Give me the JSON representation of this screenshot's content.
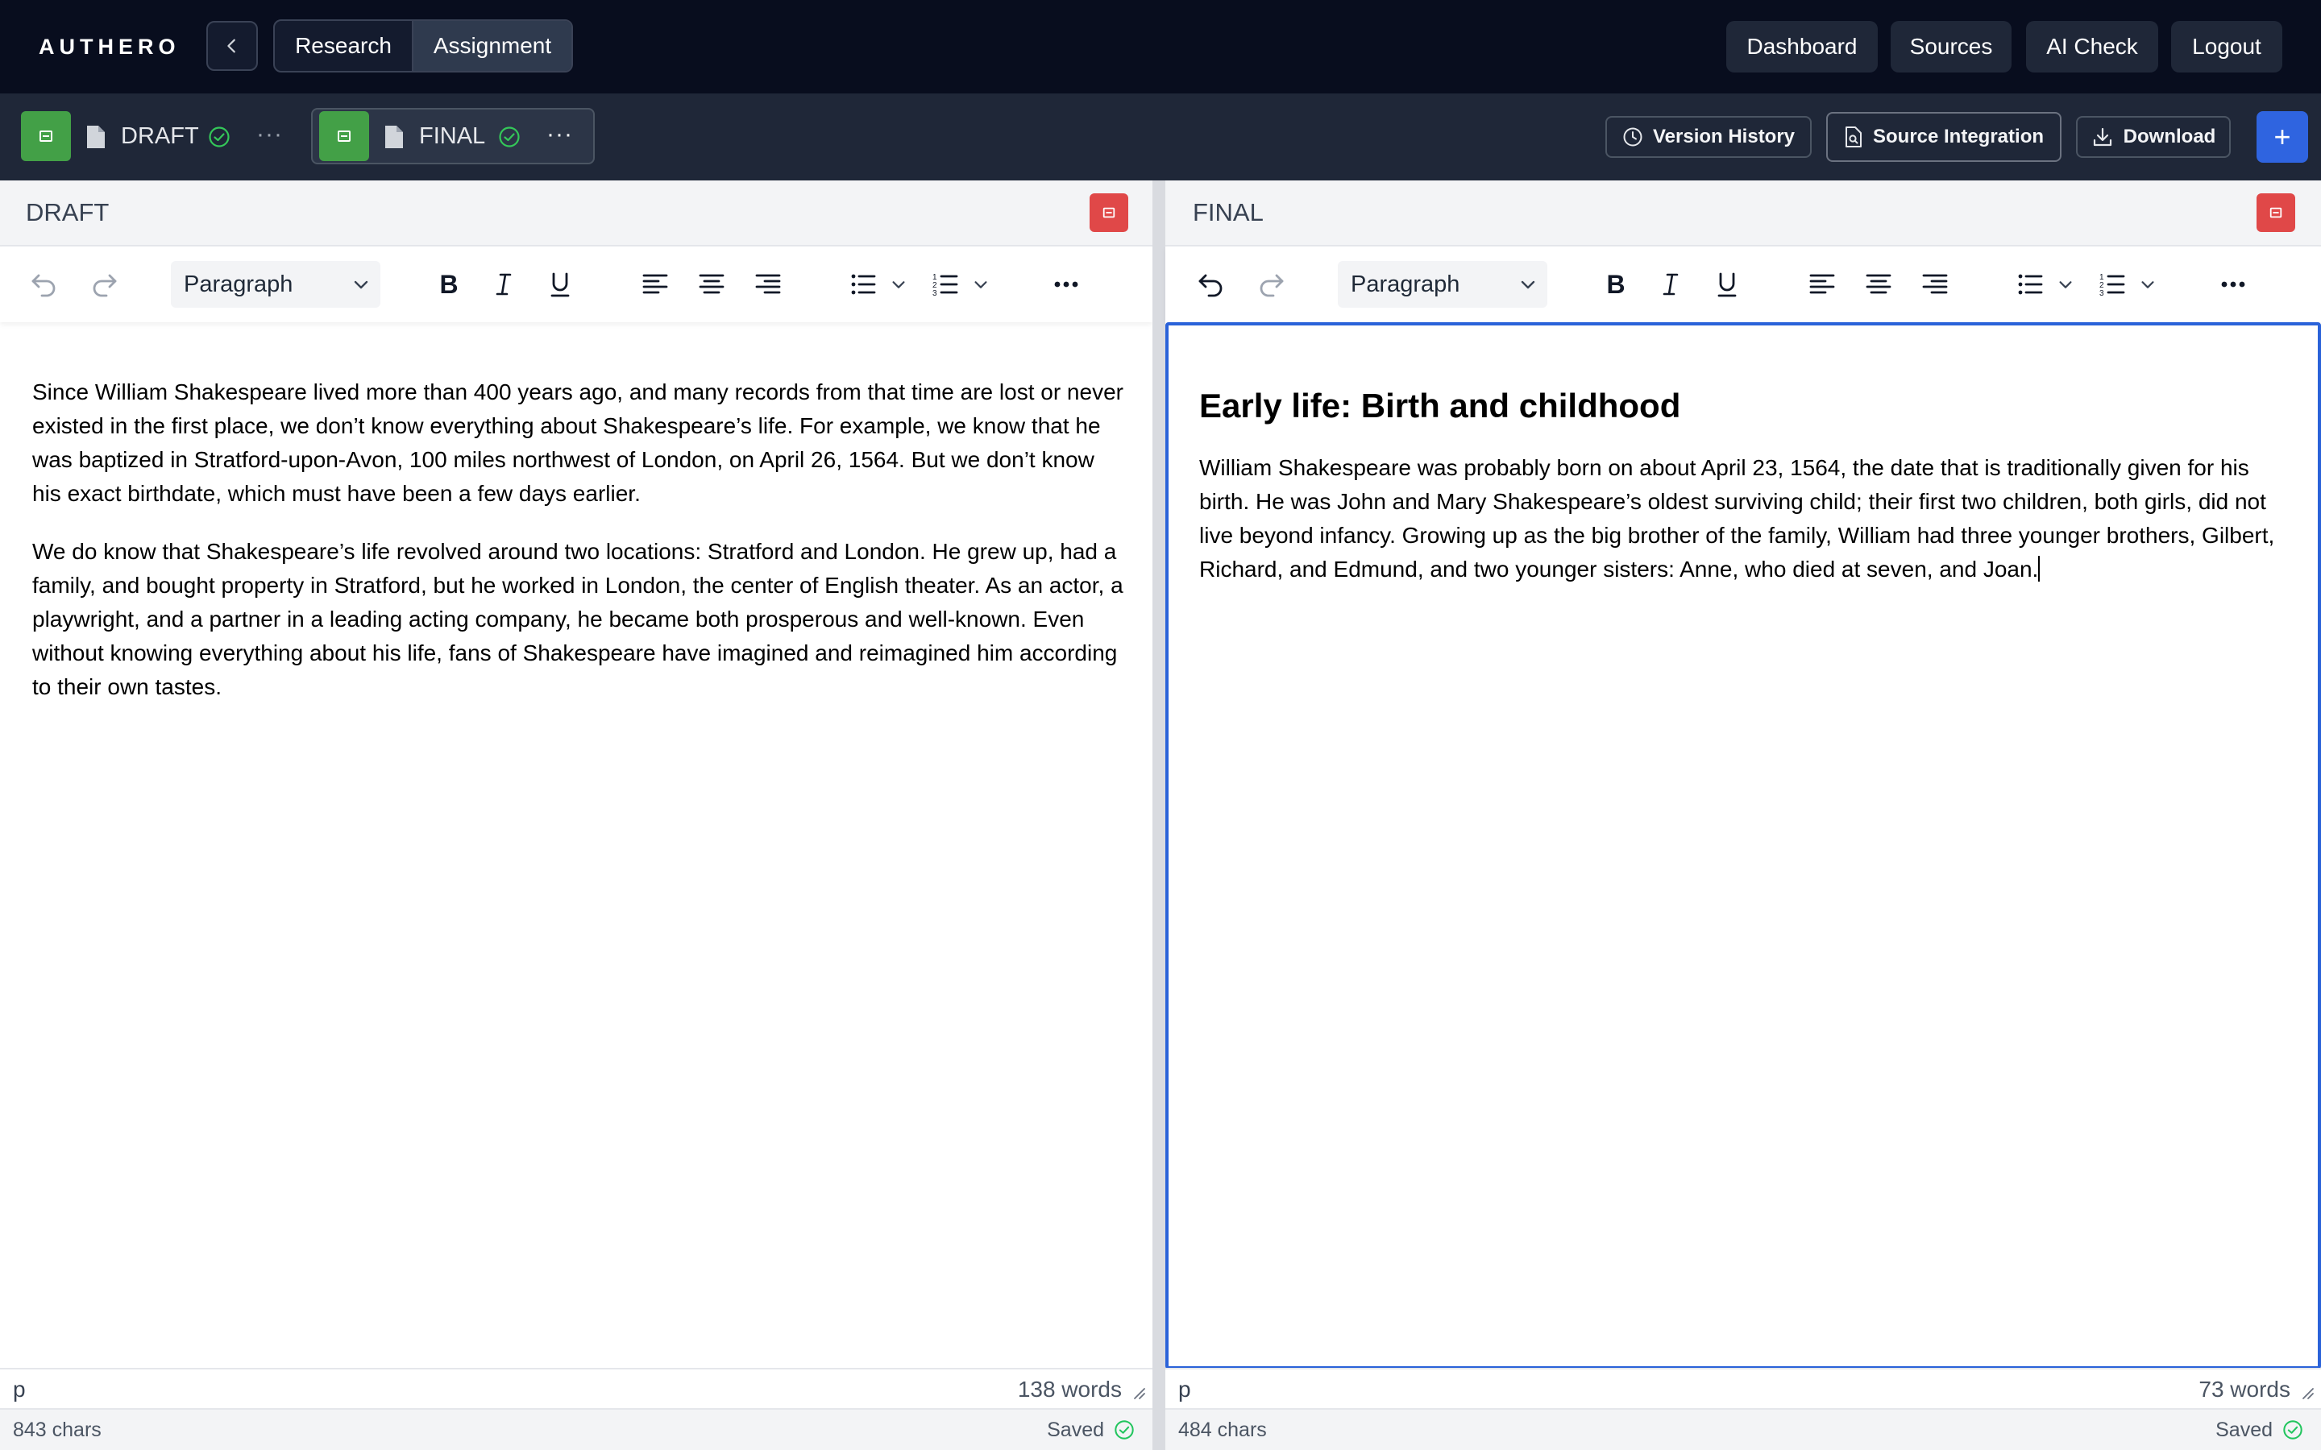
{
  "app": {
    "brand": "AUTHERO",
    "mode_tabs": [
      {
        "label": "Research",
        "active": false
      },
      {
        "label": "Assignment",
        "active": true
      }
    ],
    "nav": {
      "dashboard": "Dashboard",
      "sources": "Sources",
      "ai_check": "AI Check",
      "logout": "Logout"
    }
  },
  "docbar": {
    "tabs": [
      {
        "label": "DRAFT",
        "status": "saved"
      },
      {
        "label": "FINAL",
        "status": "saved",
        "active": true
      }
    ],
    "more": "···",
    "actions": {
      "version_history": "Version History",
      "source_integration": "Source Integration",
      "download": "Download",
      "add": "+"
    }
  },
  "panes": {
    "draft": {
      "title": "DRAFT",
      "block_type": "Paragraph",
      "paragraphs": [
        "Since William Shakespeare lived more than 400 years ago, and many records from that time are lost or never existed in the first place, we don’t know everything about Shakespeare’s life. For example, we know that he was baptized in Stratford-upon-Avon, 100 miles northwest of London, on April 26, 1564. But we don’t know his exact birthdate, which must have been a few days earlier.",
        "We do know that Shakespeare’s life revolved around two locations: Stratford and London. He grew up, had a family, and bought property in Stratford, but he worked in London, the center of English theater. As an actor, a playwright, and a partner in a leading acting company, he became both prosperous and well-known. Even without knowing everything about his life, fans of Shakespeare have imagined and reimagined him according to their own tastes."
      ],
      "status_path": "p",
      "word_count": "138 words",
      "char_count": "843 chars",
      "save_status": "Saved"
    },
    "final": {
      "title": "FINAL",
      "block_type": "Paragraph",
      "heading": "Early life: Birth and childhood",
      "paragraphs": [
        "William Shakespeare was probably born on about April 23, 1564, the date that is traditionally given for his birth. He was John and Mary Shakespeare’s oldest surviving child; their first two children, both girls, did not live beyond infancy. Growing up as the big brother of the family, William had three younger brothers, Gilbert, Richard, and Edmund, and two younger sisters: Anne, who died at seven, and Joan."
      ],
      "status_path": "p",
      "word_count": "73 words",
      "char_count": "484 chars",
      "save_status": "Saved"
    }
  },
  "colors": {
    "nav_bg": "#080d1e",
    "docbar_bg": "#1f2738",
    "accent_blue": "#2f64e0",
    "chip_green": "#43a047",
    "danger_red": "#e04848",
    "focus_border": "#2a62d9"
  }
}
